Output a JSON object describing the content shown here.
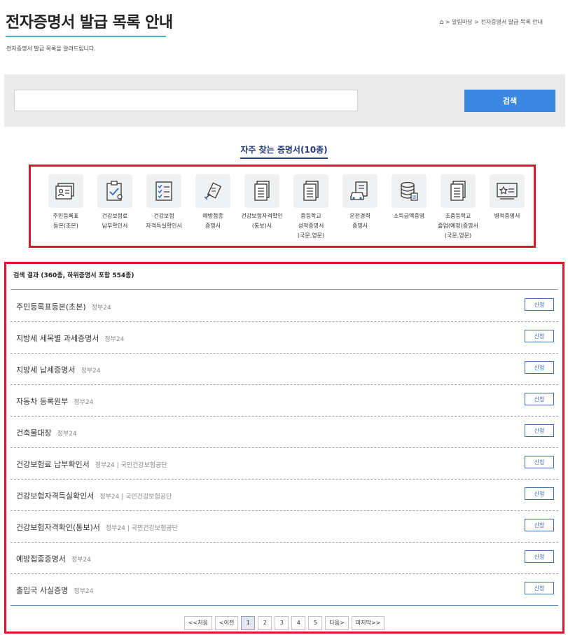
{
  "page": {
    "title": "전자증명서 발급 목록 안내",
    "subtitle": "전자증명서 발급 목록을 알려드립니다.",
    "breadcrumb": "> 알림마당 > 전자증명서 발급 목록 안내"
  },
  "search": {
    "value": "",
    "button_label": "검색"
  },
  "favorites": {
    "title": "자주 찾는 증명서(10종)",
    "items": [
      {
        "label": "주민등록표\n등본(초본)",
        "icon": "id-card-icon"
      },
      {
        "label": "건강보험료\n납부확인서",
        "icon": "clipboard-check-icon"
      },
      {
        "label": "건강보험\n자격득실확인서",
        "icon": "checklist-icon"
      },
      {
        "label": "예방접종\n증명서",
        "icon": "syringe-icon"
      },
      {
        "label": "건강보험자격확인\n(통보)서",
        "icon": "document-icon"
      },
      {
        "label": "중등학교\n성적증명서\n(국문,영문)",
        "icon": "document-icon"
      },
      {
        "label": "운전경력\n증명서",
        "icon": "car-document-icon"
      },
      {
        "label": "소득금액증명",
        "icon": "coins-icon"
      },
      {
        "label": "초중등학교\n졸업(예정)증명서\n(국문,영문)",
        "icon": "document-icon"
      },
      {
        "label": "병적증명서",
        "icon": "certificate-icon"
      }
    ]
  },
  "results": {
    "header": "검색 결과 (360종, 하위증명서 포함 554종)",
    "apply_label": "신청",
    "rows": [
      {
        "name": "주민등록표등본(초본)",
        "org": "정부24"
      },
      {
        "name": "지방세 세목별 과세증명서",
        "org": "정부24"
      },
      {
        "name": "지방세 납세증명서",
        "org": "정부24"
      },
      {
        "name": "자동차 등록원부",
        "org": "정부24"
      },
      {
        "name": "건축물대장",
        "org": "정부24"
      },
      {
        "name": "건강보험료 납부확인서",
        "org": "정부24 | 국민건강보험공단"
      },
      {
        "name": "건강보험자격득실확인서",
        "org": "정부24 | 국민건강보험공단"
      },
      {
        "name": "건강보험자격확인(통보)서",
        "org": "정부24 | 국민건강보험공단"
      },
      {
        "name": "예방접종증명서",
        "org": "정부24"
      },
      {
        "name": "출입국 사실증명",
        "org": "정부24"
      }
    ]
  },
  "pagination": {
    "first": "<<처음",
    "prev": "<이전",
    "pages": [
      "1",
      "2",
      "3",
      "4",
      "5"
    ],
    "current": "1",
    "next": "다음>",
    "last": "마지막>>"
  }
}
